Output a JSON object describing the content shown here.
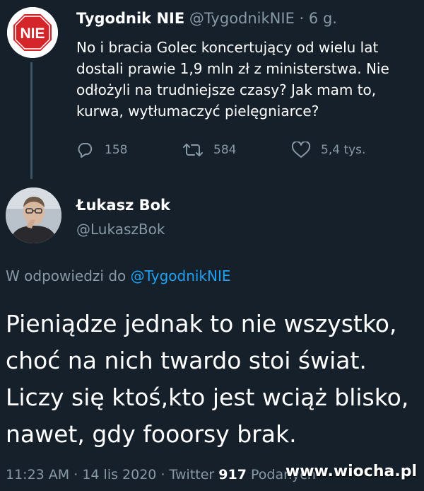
{
  "tweet": {
    "author_name": "Tygodnik NIE",
    "author_handle": "@TygodnikNIE",
    "separator": "·",
    "time_ago": "6 g.",
    "avatar_text": "NIE",
    "text": "No i bracia Golec koncertujący od wielu lat dostali prawie 1,9 mln zł z ministerstwa. Nie odłożyli na trudniejsze czasy? Jak mam to, kurwa, wytłumaczyć pielęgniarce?",
    "actions": {
      "replies": "158",
      "retweets": "584",
      "likes": "5,4 tys."
    }
  },
  "reply": {
    "author_name": "Łukasz Bok",
    "author_handle": "@LukaszBok",
    "reply_prefix": "W odpowiedzi do",
    "reply_to": "@TygodnikNIE",
    "lines": [
      "Pieniądze jednak to nie wszystko,",
      "choć na nich twardo stoi świat.",
      "Liczy się ktoś,kto jest wciąż blisko,",
      "nawet, gdy fooorsy brak."
    ],
    "timestamp": "11:23 AM",
    "date": "14 lis 2020",
    "source": "Twitter",
    "retweet_count": "917",
    "retweet_label": "Podanych"
  },
  "watermark": "www.wiocha.pl",
  "colors": {
    "background": "#15202b",
    "secondary_text": "#8899a6",
    "link": "#1da1f2",
    "nie_red": "#d4262a"
  },
  "icons": [
    "reply-icon",
    "retweet-icon",
    "like-icon",
    "stop-sign-icon"
  ]
}
